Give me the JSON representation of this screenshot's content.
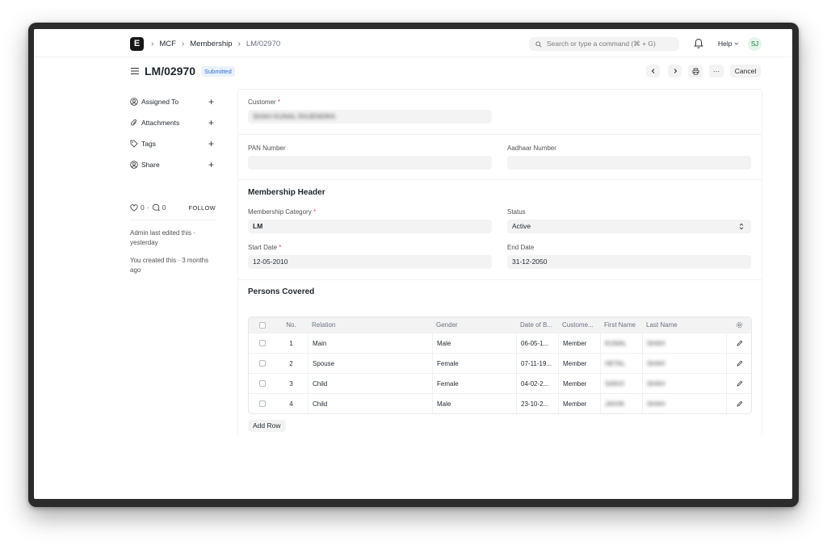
{
  "navbar": {
    "logo_letter": "E",
    "breadcrumbs": [
      "MCF",
      "Membership",
      "LM/02970"
    ],
    "search_placeholder": "Search or type a command (⌘ + G)",
    "help_label": "Help",
    "avatar_initials": "SJ"
  },
  "page": {
    "title": "LM/02970",
    "status_badge": "Submitted",
    "cancel_label": "Cancel",
    "more_label": "···"
  },
  "sidebar": {
    "items": [
      {
        "label": "Assigned To"
      },
      {
        "label": "Attachments"
      },
      {
        "label": "Tags"
      },
      {
        "label": "Share"
      }
    ],
    "likes": "0",
    "comments": "0",
    "follow_label": "FOLLOW",
    "edited_note": "Admin last edited this · yesterday",
    "created_note": "You created this · 3 months ago"
  },
  "form": {
    "customer_label": "Customer",
    "customer_value": "SHAH KUNAL RAJENDRA",
    "pan_label": "PAN Number",
    "pan_value": "",
    "aadhaar_label": "Aadhaar Number",
    "aadhaar_value": "",
    "section_header": "Membership Header",
    "membership_category_label": "Membership Category",
    "membership_category_value": "LM",
    "status_label": "Status",
    "status_value": "Active",
    "start_date_label": "Start Date",
    "start_date_value": "12-05-2010",
    "end_date_label": "End Date",
    "end_date_value": "31-12-2050",
    "persons_section": "Persons Covered",
    "add_row_label": "Add Row"
  },
  "table": {
    "headers": [
      "No.",
      "Relation",
      "Gender",
      "Date of B...",
      "Custome...",
      "First Name",
      "Last Name"
    ],
    "rows": [
      {
        "no": "1",
        "relation": "Main",
        "gender": "Male",
        "dob": "06-05-1...",
        "customer": "Member",
        "first": "KUNAL",
        "last": "SHAH"
      },
      {
        "no": "2",
        "relation": "Spouse",
        "gender": "Female",
        "dob": "07-11-19...",
        "customer": "Member",
        "first": "HETAL",
        "last": "SHAH"
      },
      {
        "no": "3",
        "relation": "Child",
        "gender": "Female",
        "dob": "04-02-2...",
        "customer": "Member",
        "first": "SANVI",
        "last": "SHAH"
      },
      {
        "no": "4",
        "relation": "Child",
        "gender": "Male",
        "dob": "23-10-2...",
        "customer": "Member",
        "first": "JAIVIK",
        "last": "SHAH"
      }
    ]
  },
  "colors": {
    "accent": "#2f6dd0",
    "badge_bg": "#eaf2fd",
    "field_bg": "#f3f3f3",
    "required": "#e24c4c"
  }
}
